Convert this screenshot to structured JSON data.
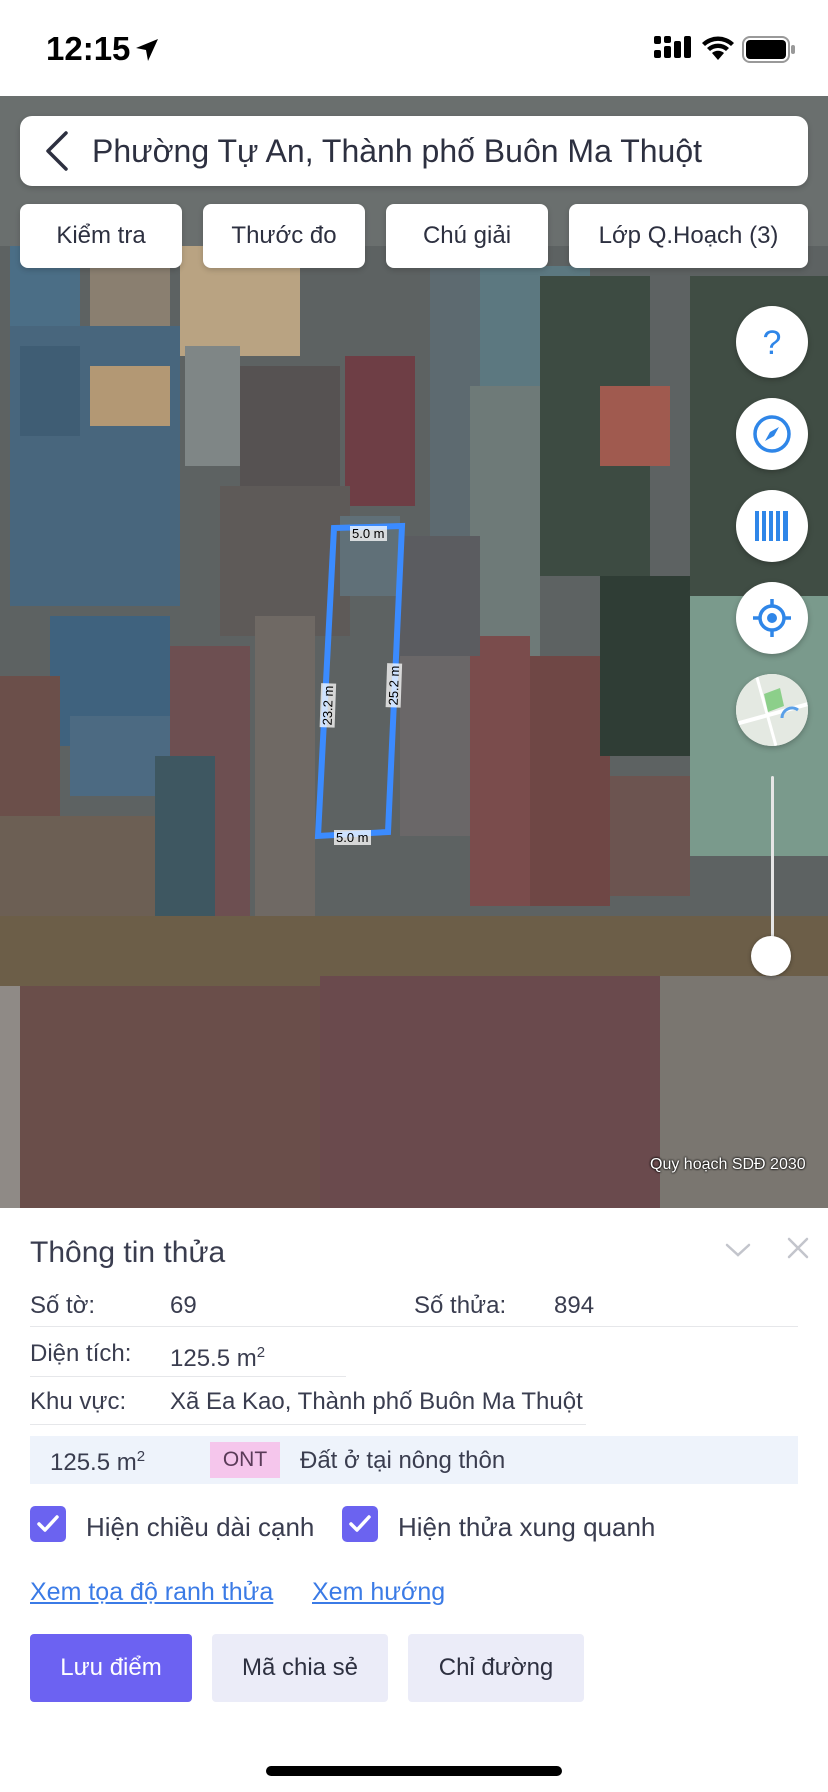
{
  "status_bar": {
    "time": "12:15"
  },
  "search": {
    "title": "Phường Tự An, Thành phố Buôn Ma Thuột"
  },
  "toolbar": {
    "chips": [
      "Kiểm tra",
      "Thước đo",
      "Chú giải",
      "Lớp Q.Hoạch (3)"
    ]
  },
  "map": {
    "parcel_edges": {
      "top": "5.0 m",
      "bottom": "5.0 m",
      "left": "23.2 m",
      "right": "25.2 m"
    },
    "credit": "Quy hoạch SDĐ 2030",
    "parcel_color": "#3b8bff",
    "controls": [
      "help-icon",
      "compass-icon",
      "barcode-icon",
      "locate-icon",
      "map-thumbnail-icon"
    ]
  },
  "parcel_info": {
    "title": "Thông tin thửa",
    "sheet_label": "Số tờ:",
    "sheet_value": "69",
    "parcel_label": "Số thửa:",
    "parcel_value": "894",
    "area_label": "Diện tích:",
    "area_value": "125.5 m",
    "area_unit_sup": "2",
    "region_label": "Khu vực:",
    "region_value": "Xã Ea Kao, Thành phố Buôn Ma Thuột",
    "zone": {
      "area": "125.5 m",
      "area_sup": "2",
      "code": "ONT",
      "name": "Đất ở tại nông thôn"
    },
    "show_edge_length": {
      "label": "Hiện chiều dài cạnh",
      "checked": true
    },
    "show_neighbors": {
      "label": "Hiện thửa xung quanh",
      "checked": true
    },
    "link_coords": "Xem tọa độ ranh thửa",
    "link_direction": "Xem hướng",
    "buttons": {
      "save": "Lưu điểm",
      "share": "Mã chia sẻ",
      "directions": "Chỉ đường"
    }
  },
  "colors": {
    "accent": "#6c62f2",
    "link": "#3b7be6",
    "zone_badge": "#f5c6ec"
  }
}
